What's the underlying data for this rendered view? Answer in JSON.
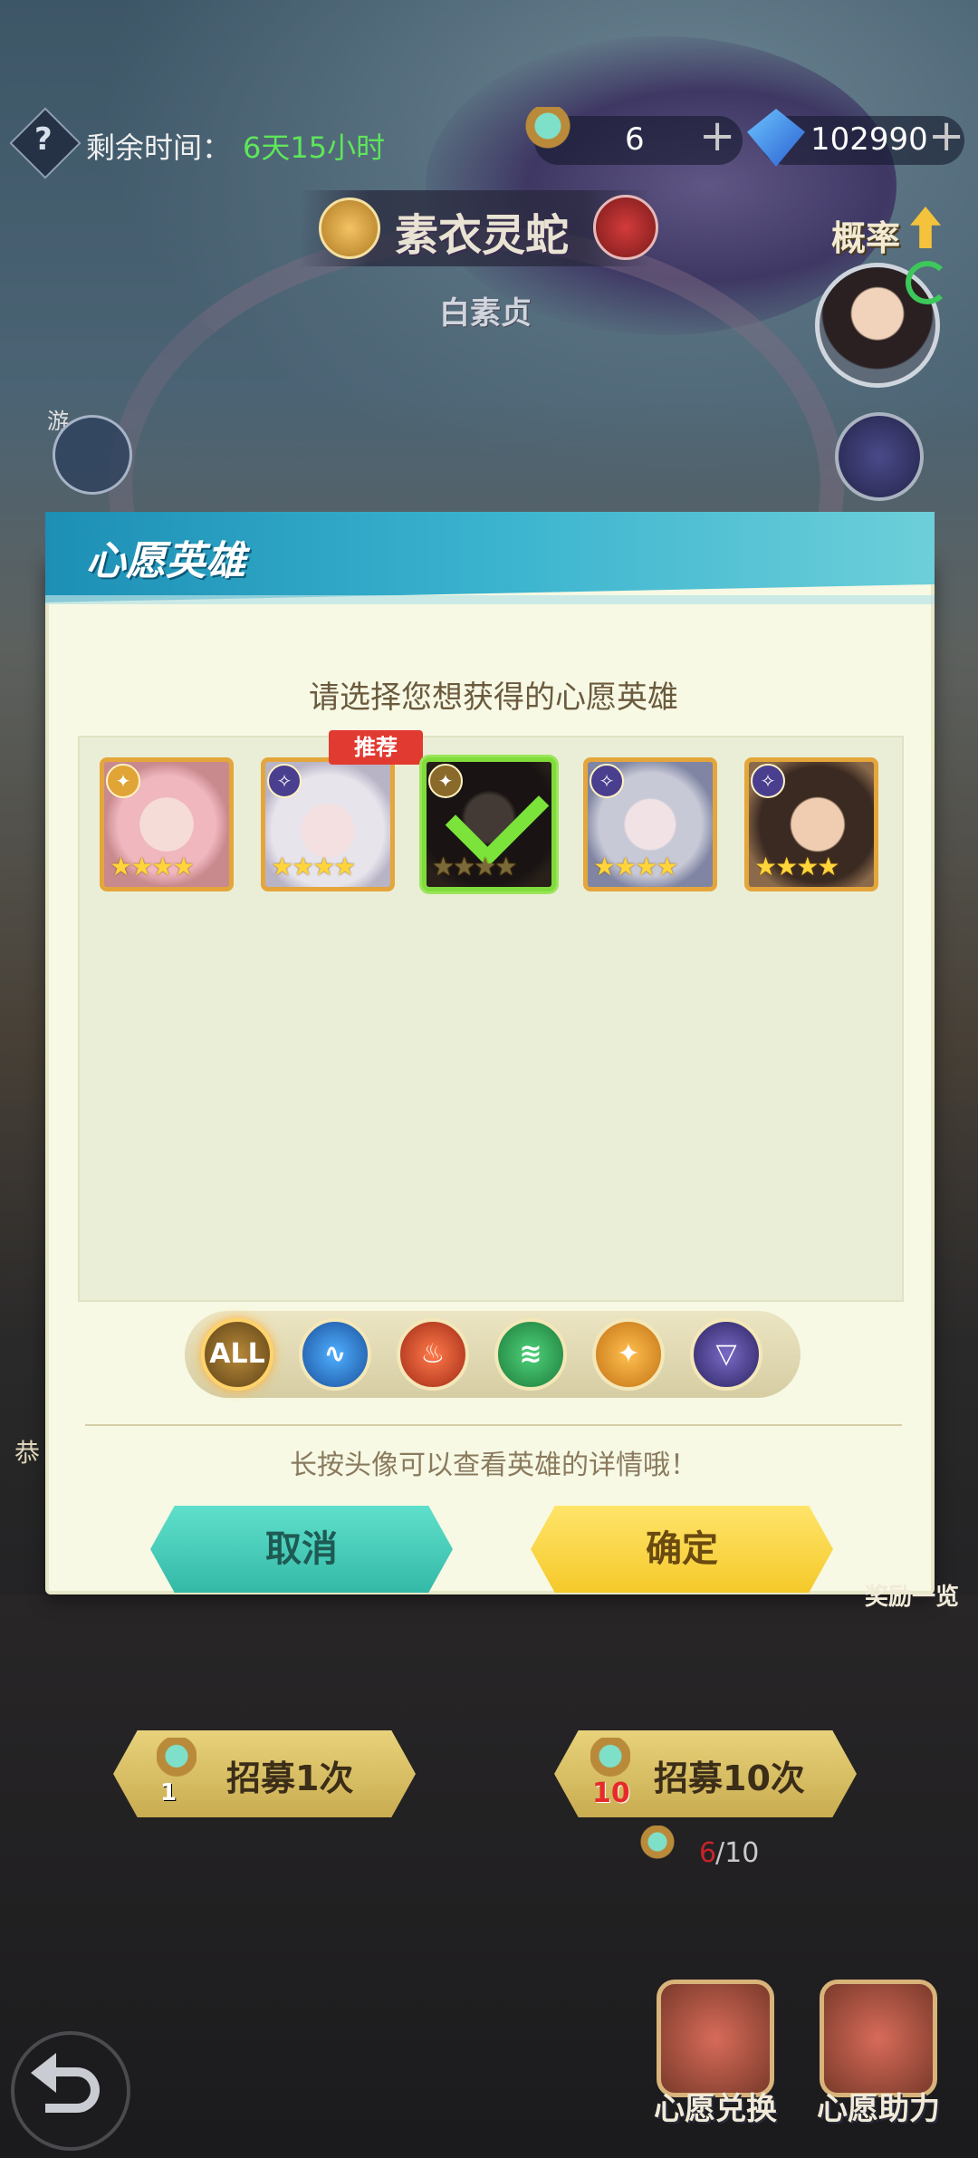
{
  "top_bar": {
    "help_icon": "?",
    "time_label": "剩余时间：",
    "time_value": "6天15小时",
    "token_count": "6",
    "gem_count": "102990",
    "plus": "+"
  },
  "banner": {
    "name": "素衣灵蛇",
    "subtitle": "白素贞",
    "rate_label": "概率",
    "side_tag": "游"
  },
  "dialog": {
    "title": "心愿英雄",
    "prompt": "请选择您想获得的心愿英雄",
    "recommend_badge": "推荐",
    "hint": "长按头像可以查看英雄的详情哦！",
    "cancel": "取消",
    "confirm": "确定",
    "heroes": [
      {
        "stars": "★★★★",
        "faction": "light",
        "selected": false,
        "recommended": false
      },
      {
        "stars": "★★★★",
        "faction": "dark",
        "selected": false,
        "recommended": true
      },
      {
        "stars": "★★★★",
        "faction": "light",
        "selected": true,
        "recommended": false
      },
      {
        "stars": "★★★★",
        "faction": "dark",
        "selected": false,
        "recommended": false
      },
      {
        "stars": "★★★★",
        "faction": "dark",
        "selected": false,
        "recommended": false
      }
    ],
    "filters": [
      {
        "label": "ALL",
        "color": "#8a6a2a"
      },
      {
        "label": "",
        "color": "#1f6fc9"
      },
      {
        "label": "",
        "color": "#d2432a"
      },
      {
        "label": "",
        "color": "#2aa24d"
      },
      {
        "label": "",
        "color": "#e99a2c"
      },
      {
        "label": "",
        "color": "#4a3f8f"
      }
    ]
  },
  "recruit": {
    "once_label": "招募1次",
    "once_cost": "1",
    "ten_label": "招募10次",
    "ten_cost": "10",
    "progress_current": "6",
    "progress_total": "/10"
  },
  "bottom": {
    "exchange_label": "心愿兑换",
    "assist_label": "心愿助力",
    "side_left": "恭",
    "reward_label": "奖励一览"
  },
  "colors": {
    "time_green": "#5ee65a",
    "header_blue": "#2aa6c8",
    "cancel_teal": "#45c9b6",
    "confirm_yellow": "#f7d23e"
  }
}
